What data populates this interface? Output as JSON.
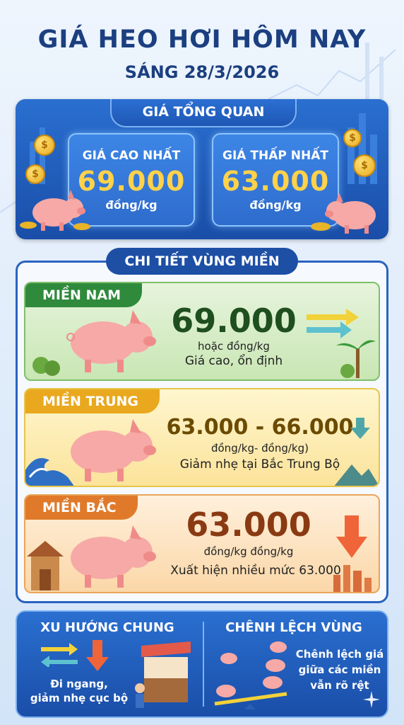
{
  "header": {
    "title": "GIÁ HEO HƠI HÔM NAY",
    "subtitle": "SÁNG 28/3/2026"
  },
  "overview": {
    "tab_label": "GIÁ TỔNG QUAN",
    "high": {
      "label": "GIÁ CAO NHẤT",
      "value": "69.000",
      "unit": "đồng/kg"
    },
    "low": {
      "label": "GIÁ THẤP NHẤT",
      "value": "63.000",
      "unit": "đồng/kg"
    },
    "coin_symbol": "$"
  },
  "regions": {
    "tab_label": "CHI TIẾT VÙNG MIỀN",
    "south": {
      "label": "MIỀN NAM",
      "value": "69.000",
      "unit": "hoặc đồng/kg",
      "note": "Giá cao, ổn định",
      "trend_icon": "arrows-right-icon"
    },
    "central": {
      "label": "MIỀN TRUNG",
      "value": "63.000 - 66.000",
      "unit": "đồng/kg- đồng/kg)",
      "note": "Giảm nhẹ tại Bắc Trung Bộ",
      "trend_icon": "arrow-down-icon"
    },
    "north": {
      "label": "MIỀN BẮC",
      "value": "63.000",
      "unit": "đồng/kg  đồng/kg",
      "note": "Xuất hiện nhiều mức 63.000",
      "trend_icon": "arrow-down-icon"
    }
  },
  "summary": {
    "trend": {
      "title": "XU HƯỚNG CHUNG",
      "text_line1": "Đi ngang,",
      "text_line2": "giảm nhẹ cục bộ"
    },
    "gap": {
      "title": "CHÊNH LỆCH VÙNG",
      "text_line1": "Chênh lệch giá",
      "text_line2": "giữa các miền",
      "text_line3": "vẫn rõ rệt"
    }
  },
  "colors": {
    "navy": "#1b3f80",
    "green_value": "#1f4e1f",
    "olive_value": "#6b4a00",
    "rust_value": "#8a3a12",
    "gold": "#ffd24a",
    "arrow_orange": "#f0643a"
  }
}
